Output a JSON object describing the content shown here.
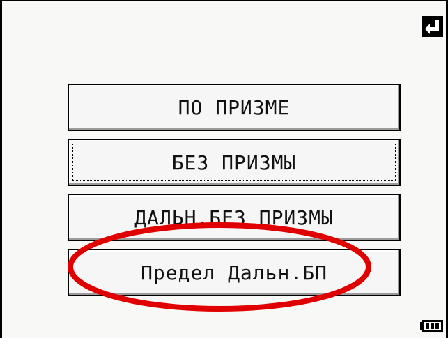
{
  "icons": {
    "enter": "enter-return-icon",
    "battery": "battery-icon"
  },
  "menu": {
    "items": [
      {
        "label": "ПО ПРИЗМЕ"
      },
      {
        "label": "БЕЗ ПРИЗМЫ"
      },
      {
        "label": "ДАЛЬН.БЕЗ ПРИЗМЫ"
      },
      {
        "label": "Предел Дальн.БП"
      }
    ]
  },
  "annotation": {
    "color": "#e00000"
  }
}
